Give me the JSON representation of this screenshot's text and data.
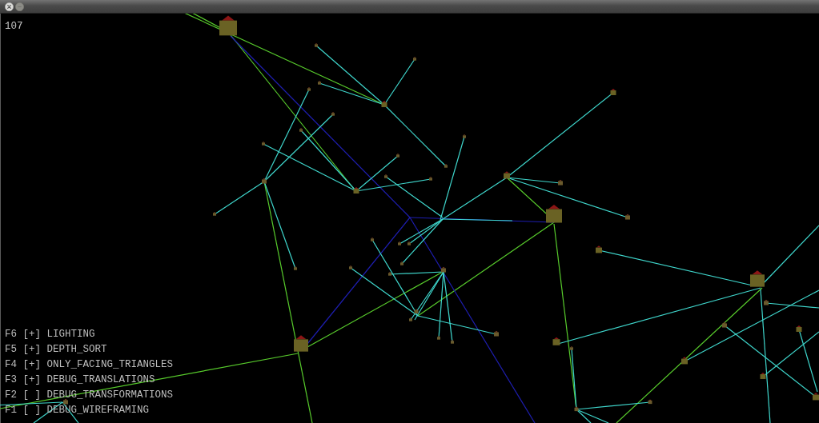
{
  "hud": {
    "counter": "107"
  },
  "debug_options": [
    {
      "key": "F6",
      "toggle": "[+]",
      "label": "LIGHTING"
    },
    {
      "key": "F5",
      "toggle": "[+]",
      "label": "DEPTH_SORT"
    },
    {
      "key": "F4",
      "toggle": "[+]",
      "label": "ONLY_FACING_TRIANGLES"
    },
    {
      "key": "F3",
      "toggle": "[+]",
      "label": "DEBUG_TRANSLATIONS"
    },
    {
      "key": "F2",
      "toggle": "[ ]",
      "label": "DEBUG_TRANSFORMATIONS"
    },
    {
      "key": "F1",
      "toggle": "[ ]",
      "label": "DEBUG_WIREFRAMING"
    }
  ]
}
